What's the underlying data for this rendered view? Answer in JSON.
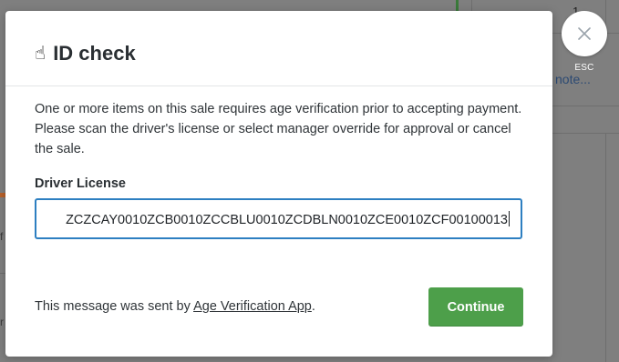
{
  "background": {
    "qty": "1",
    "note_link": "note...",
    "fragment_left_1": "f",
    "fragment_left_2": "r"
  },
  "close": {
    "esc_label": "ESC",
    "icon": "close-icon"
  },
  "modal": {
    "icon": "☝",
    "title": "ID check",
    "message": "One or more items on this sale requires age verification prior to accepting payment. Please scan the driver's license or select manager override for approval or cancel the sale.",
    "field_label": "Driver License",
    "field_value": "ZCZCAY0010ZCB0010ZCCBLU0010ZCDBLN0010ZCE0010ZCF00100013",
    "footer_prefix": "This message was sent by ",
    "footer_link": "Age Verification App",
    "footer_suffix": ".",
    "continue_label": "Continue"
  },
  "colors": {
    "accent_blue": "#2d7fc1",
    "continue_green": "#4d9f4a",
    "overlay": "#7f7f7f"
  }
}
